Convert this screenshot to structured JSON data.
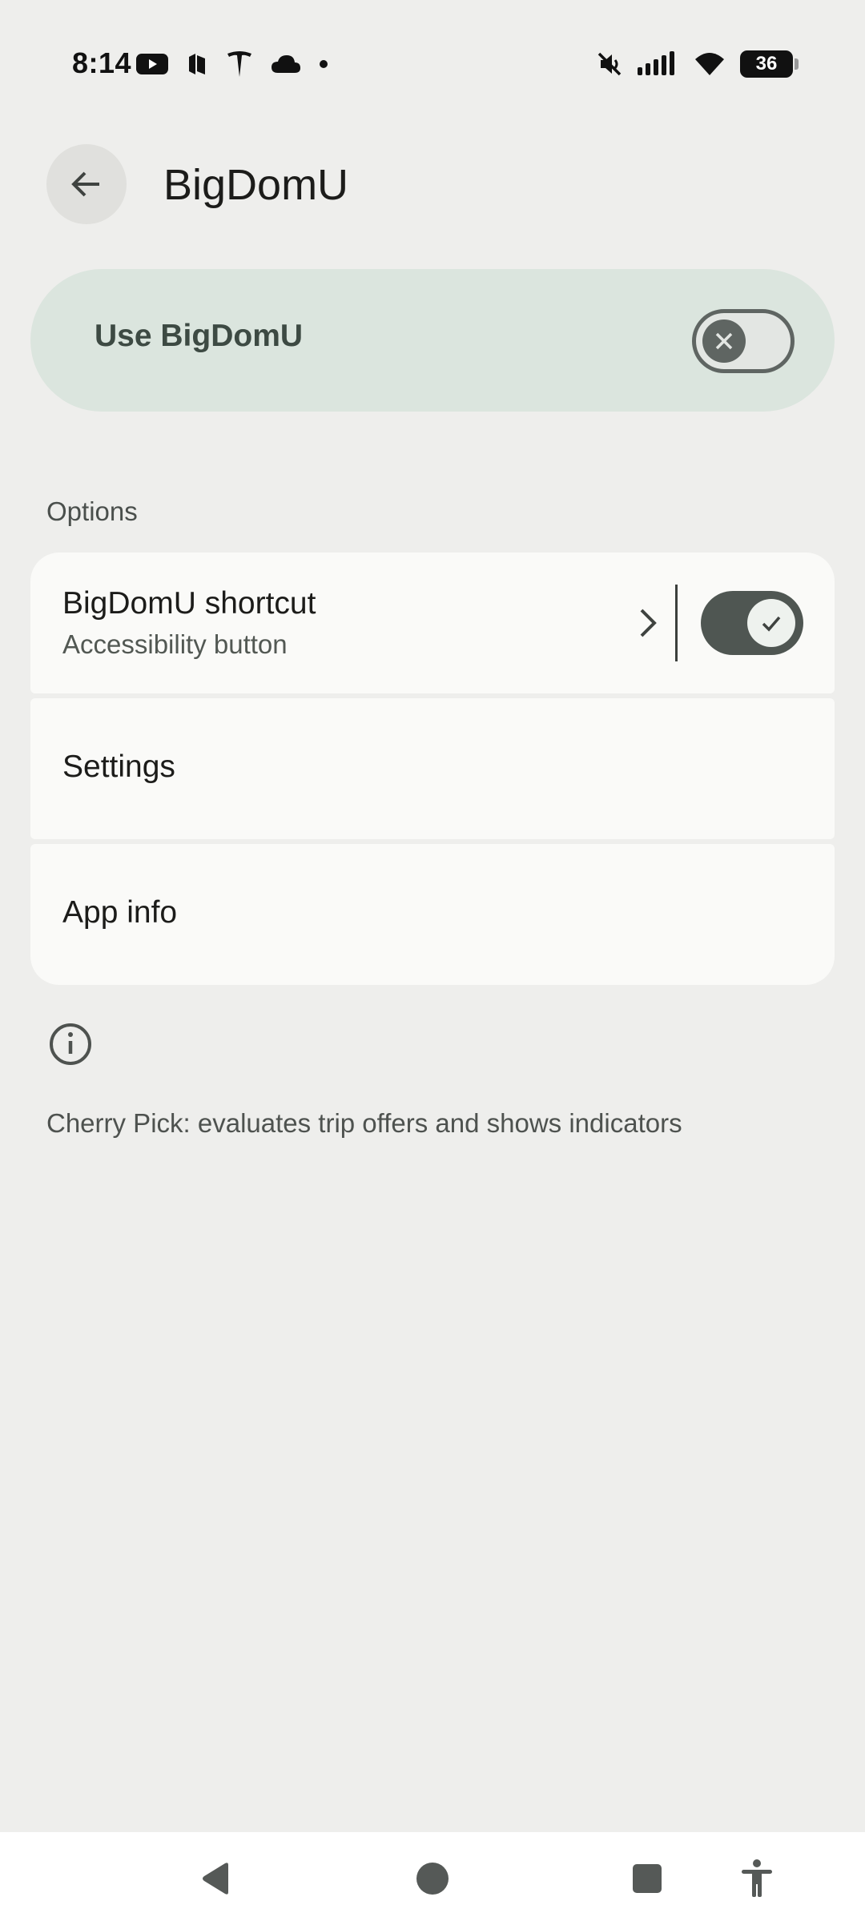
{
  "status_bar": {
    "time": "8:14",
    "battery_level": "36",
    "left_icons": [
      "youtube-icon",
      "app-icon",
      "tesla-icon",
      "cloud-icon",
      "dot-icon"
    ],
    "right_icons": [
      "mute-icon",
      "signal-icon",
      "wifi-icon",
      "battery-icon"
    ]
  },
  "header": {
    "title": "BigDomU",
    "back_icon": "arrow-back-icon"
  },
  "main_switch": {
    "label": "Use BigDomU",
    "enabled": false
  },
  "options": {
    "section_label": "Options",
    "shortcut": {
      "title": "BigDomU shortcut",
      "subtitle": "Accessibility button",
      "enabled": true
    },
    "settings_label": "Settings",
    "app_info_label": "App info"
  },
  "footer": {
    "description": "Cherry Pick: evaluates trip offers and shows indicators"
  },
  "nav_bar": {
    "buttons": [
      "back-icon",
      "home-icon",
      "recents-icon",
      "accessibility-icon"
    ]
  },
  "colors": {
    "background": "#eeeeec",
    "main_switch_bg": "#dbe5de",
    "card_bg": "#fafaf8",
    "toggle_dark": "#4f5652"
  }
}
